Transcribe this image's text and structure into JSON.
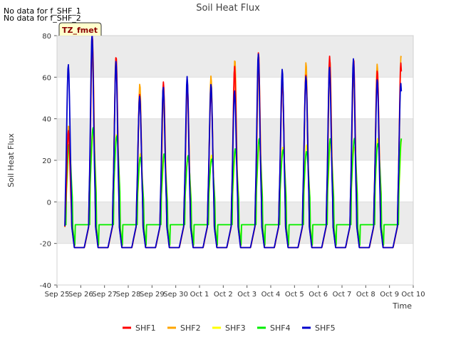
{
  "notes": [
    "No data for f_SHF_1",
    "No data for f_SHF_2"
  ],
  "badge": "TZ_fmet",
  "chart_data": {
    "type": "line",
    "title": "Soil Heat Flux",
    "xlabel": "Time",
    "ylabel": "Soil Heat Flux",
    "ylim": [
      -40,
      80
    ],
    "yticks": [
      -40,
      -20,
      0,
      20,
      40,
      60,
      80
    ],
    "xlim": [
      "2024-09-25",
      "2024-10-10"
    ],
    "x_ticks": [
      "Sep 25",
      "Sep 26",
      "Sep 27",
      "Sep 28",
      "Sep 29",
      "Sep 30",
      "Oct 1",
      "Oct 2",
      "Oct 3",
      "Oct 4",
      "Oct 5",
      "Oct 6",
      "Oct 7",
      "Oct 8",
      "Oct 9",
      "Oct 10"
    ],
    "data_start": "2024-09-25T08:00",
    "data_end": "2024-10-09T12:00",
    "night_value_approx": -22,
    "daily_peaks": {
      "days": [
        "Sep 25",
        "Sep 26",
        "Sep 27",
        "Sep 28",
        "Sep 29",
        "Sep 30",
        "Oct 1",
        "Oct 2",
        "Oct 3",
        "Oct 4",
        "Oct 5",
        "Oct 6",
        "Oct 7",
        "Oct 8",
        "Oct 9"
      ],
      "series": [
        {
          "name": "SHF1",
          "color": "#ff0000",
          "values": [
            34,
            76,
            72,
            54,
            55,
            56,
            57,
            65,
            68,
            60,
            64,
            67,
            67,
            67,
            67
          ]
        },
        {
          "name": "SHF2",
          "color": "#ffa500",
          "values": [
            35,
            79,
            72,
            54,
            52,
            58,
            60,
            65,
            67,
            62,
            64,
            66,
            65,
            66,
            67
          ]
        },
        {
          "name": "SHF3",
          "color": "#ffff00",
          "values": [
            26,
            34,
            33,
            22,
            22,
            22,
            22,
            24,
            28,
            27,
            26,
            28,
            28,
            30,
            30
          ]
        },
        {
          "name": "SHF4",
          "color": "#00ee00",
          "values": [
            27,
            34,
            33,
            22,
            22,
            22,
            22,
            25,
            29,
            26,
            25,
            29,
            30,
            30,
            30
          ]
        },
        {
          "name": "SHF5",
          "color": "#0000cc",
          "values": [
            69,
            77,
            66,
            54,
            55,
            57,
            58,
            56,
            68,
            62,
            64,
            65,
            65,
            60,
            60
          ]
        }
      ]
    },
    "legend": {
      "placement": "bottom",
      "entries": [
        "SHF1",
        "SHF2",
        "SHF3",
        "SHF4",
        "SHF5"
      ]
    },
    "grid": true,
    "background_bands": "#ebebeb"
  }
}
